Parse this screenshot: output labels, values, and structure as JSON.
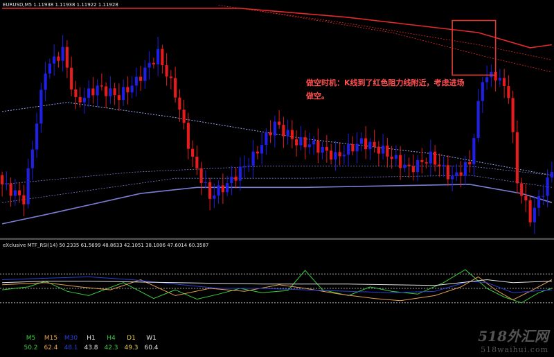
{
  "header": {
    "symbol_line": "EURUSD,M5  1.11938 1.11938 1.11922 1.11928",
    "rsi_line": "eXclusive MTF_RSI(14) 50.2335 61.5699 48.8633 42.1051 38.1806 47.6014 60.3587"
  },
  "annotation": {
    "line1": "做空时机：K线到了红色阻力线附近，考虑进场",
    "line2": "做空。"
  },
  "colors": {
    "bull": "#1f1fe6",
    "bear": "#e81c1c",
    "resistance": "#e52a2a",
    "support": "#7a7fd6",
    "mid": "#9aa6f0",
    "box": "#e0392f",
    "level": "#cfcfcf",
    "grid": "#3a3a3a"
  },
  "timeframes": [
    {
      "name": "M5",
      "value": "50.2",
      "color": "#3ccf3c"
    },
    {
      "name": "M15",
      "value": "62.4",
      "color": "#e8a050"
    },
    {
      "name": "M30",
      "value": "48.1",
      "color": "#2a3fd6"
    },
    {
      "name": "H1",
      "value": "43.8",
      "color": "#e6e6e6"
    },
    {
      "name": "H4",
      "value": "42.3",
      "color": "#3ccf3c"
    },
    {
      "name": "D1",
      "value": "49.3",
      "color": "#e6d24a"
    },
    {
      "name": "W1",
      "value": "60.4",
      "color": "#e6e6e6"
    }
  ],
  "watermark": {
    "main": "518外汇网",
    "sub": "518waihui.com"
  },
  "chart_data": {
    "type": "candlestick",
    "symbol": "EURUSD",
    "timeframe": "M5",
    "quote": {
      "open": 1.11938,
      "high": 1.11938,
      "low": 1.11922,
      "close": 1.11928
    },
    "ylim": [
      1.117,
      1.1244
    ],
    "bar_count": 128,
    "close_path": [
      [
        0,
        1.1186
      ],
      [
        5,
        1.1181
      ],
      [
        10,
        1.1224
      ],
      [
        14,
        1.123
      ],
      [
        17,
        1.1213
      ],
      [
        22,
        1.1218
      ],
      [
        27,
        1.1215
      ],
      [
        31,
        1.122
      ],
      [
        36,
        1.1229
      ],
      [
        40,
        1.1216
      ],
      [
        44,
        1.1194
      ],
      [
        48,
        1.1182
      ],
      [
        52,
        1.1186
      ],
      [
        58,
        1.1195
      ],
      [
        63,
        1.1206
      ],
      [
        68,
        1.12
      ],
      [
        72,
        1.1199
      ],
      [
        77,
        1.1195
      ],
      [
        83,
        1.12
      ],
      [
        88,
        1.1197
      ],
      [
        94,
        1.1191
      ],
      [
        99,
        1.1195
      ],
      [
        104,
        1.1188
      ],
      [
        108,
        1.1193
      ],
      [
        111,
        1.1221
      ],
      [
        114,
        1.1222
      ],
      [
        117,
        1.1216
      ],
      [
        119,
        1.1187
      ],
      [
        122,
        1.1175
      ],
      [
        124,
        1.1181
      ],
      [
        127,
        1.119
      ]
    ],
    "mid_band": [
      [
        0,
        1.121
      ],
      [
        15,
        1.1213
      ],
      [
        40,
        1.1208
      ],
      [
        70,
        1.1201
      ],
      [
        100,
        1.1196
      ],
      [
        127,
        1.1189
      ]
    ],
    "upper_band": [
      [
        0,
        1.1244
      ],
      [
        55,
        1.1244
      ],
      [
        80,
        1.1241
      ],
      [
        110,
        1.1236
      ],
      [
        122,
        1.1231
      ],
      [
        127,
        1.1232
      ]
    ],
    "upper_band_2": [
      [
        50,
        1.1245
      ],
      [
        80,
        1.1239
      ],
      [
        110,
        1.1232
      ],
      [
        127,
        1.1227
      ]
    ],
    "upper_band_3": [
      [
        60,
        1.1243
      ],
      [
        90,
        1.1236
      ],
      [
        112,
        1.1228
      ],
      [
        127,
        1.1223
      ]
    ],
    "lower_band": [
      [
        0,
        1.1173
      ],
      [
        10,
        1.1176
      ],
      [
        32,
        1.1183
      ],
      [
        45,
        1.1185
      ],
      [
        70,
        1.1185
      ],
      [
        108,
        1.1186
      ],
      [
        120,
        1.1183
      ],
      [
        127,
        1.118
      ]
    ],
    "lower_band_2": [
      [
        0,
        1.118
      ],
      [
        20,
        1.1184
      ],
      [
        40,
        1.1188
      ],
      [
        70,
        1.1188
      ],
      [
        108,
        1.1189
      ],
      [
        127,
        1.1185
      ]
    ],
    "lower_band_3": [
      [
        0,
        1.1186
      ],
      [
        30,
        1.119
      ],
      [
        60,
        1.1192
      ],
      [
        108,
        1.1192
      ],
      [
        127,
        1.1189
      ]
    ],
    "highlight_box": {
      "x_start": 104,
      "x_end": 114,
      "y_top": 1.124,
      "y_bottom": 1.1222
    },
    "rsi": {
      "ylim": [
        0,
        100
      ],
      "levels": [
        30,
        50,
        70
      ],
      "series": [
        {
          "name": "M5",
          "color": "#3ccf3c",
          "values": [
            [
              0,
              48
            ],
            [
              6,
              52
            ],
            [
              10,
              60
            ],
            [
              15,
              46
            ],
            [
              20,
              40
            ],
            [
              28,
              58
            ],
            [
              35,
              36
            ],
            [
              40,
              48
            ],
            [
              45,
              35
            ],
            [
              50,
              42
            ],
            [
              55,
              50
            ],
            [
              60,
              44
            ],
            [
              66,
              47
            ],
            [
              70,
              75
            ],
            [
              74,
              48
            ],
            [
              80,
              40
            ],
            [
              85,
              52
            ],
            [
              90,
              46
            ],
            [
              96,
              42
            ],
            [
              102,
              58
            ],
            [
              107,
              76
            ],
            [
              112,
              50
            ],
            [
              116,
              38
            ],
            [
              120,
              30
            ],
            [
              124,
              44
            ],
            [
              127,
              50
            ]
          ]
        },
        {
          "name": "M15",
          "color": "#e8a050",
          "values": [
            [
              0,
              55
            ],
            [
              10,
              58
            ],
            [
              18,
              52
            ],
            [
              25,
              48
            ],
            [
              32,
              62
            ],
            [
              40,
              40
            ],
            [
              48,
              50
            ],
            [
              56,
              46
            ],
            [
              64,
              55
            ],
            [
              70,
              50
            ],
            [
              78,
              42
            ],
            [
              86,
              36
            ],
            [
              92,
              33
            ],
            [
              100,
              40
            ],
            [
              106,
              52
            ],
            [
              110,
              66
            ],
            [
              114,
              48
            ],
            [
              118,
              34
            ],
            [
              122,
              46
            ],
            [
              127,
              62
            ]
          ]
        },
        {
          "name": "M30",
          "color": "#2a3fd6",
          "values": [
            [
              0,
              62
            ],
            [
              10,
              64
            ],
            [
              20,
              66
            ],
            [
              30,
              62
            ],
            [
              40,
              56
            ],
            [
              50,
              50
            ],
            [
              60,
              50
            ],
            [
              70,
              48
            ],
            [
              80,
              46
            ],
            [
              90,
              44
            ],
            [
              100,
              46
            ],
            [
              108,
              60
            ],
            [
              112,
              58
            ],
            [
              118,
              44
            ],
            [
              127,
              48
            ]
          ]
        },
        {
          "name": "H1",
          "color": "#e6e6e6",
          "values": [
            [
              0,
              58
            ],
            [
              10,
              60
            ],
            [
              20,
              60
            ],
            [
              40,
              58
            ],
            [
              60,
              56
            ],
            [
              80,
              56
            ],
            [
              100,
              54
            ],
            [
              106,
              58
            ],
            [
              112,
              62
            ],
            [
              118,
              58
            ],
            [
              127,
              60
            ]
          ]
        }
      ]
    }
  }
}
